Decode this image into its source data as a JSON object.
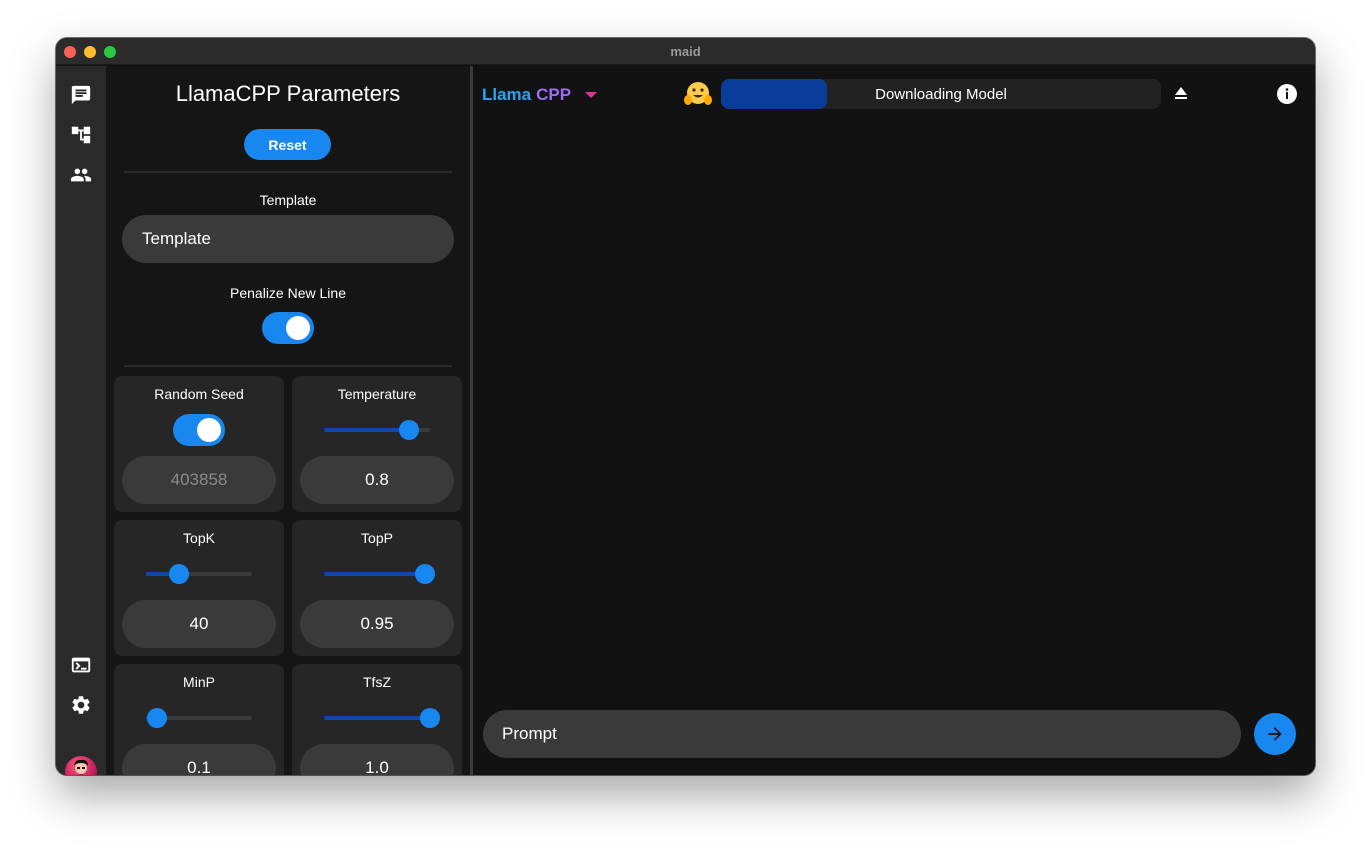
{
  "window": {
    "title": "maid"
  },
  "rail": {
    "items": [
      {
        "icon": "chat-icon"
      },
      {
        "icon": "hierarchy-icon"
      },
      {
        "icon": "people-icon"
      },
      {
        "icon": "terminal-icon"
      },
      {
        "icon": "gear-icon"
      },
      {
        "icon": "avatar"
      }
    ]
  },
  "panel": {
    "title": "LlamaCPP Parameters",
    "reset_label": "Reset",
    "template_label": "Template",
    "template_placeholder": "Template",
    "penalize_label": "Penalize New Line",
    "penalize_on": true,
    "cards": [
      {
        "label": "Random Seed",
        "value": "403858",
        "toggle_on": true
      },
      {
        "label": "Temperature",
        "value": "0.8",
        "slider_fraction": 0.8
      },
      {
        "label": "TopK",
        "value": "40",
        "slider_fraction": 0.31
      },
      {
        "label": "TopP",
        "value": "0.95",
        "slider_fraction": 0.95
      },
      {
        "label": "MinP",
        "value": "0.1",
        "slider_fraction": 0.1
      },
      {
        "label": "TfsZ",
        "value": "1.0",
        "slider_fraction": 1.0
      }
    ]
  },
  "main": {
    "api_part1": "Llama",
    "api_part2": "CPP",
    "progress_text": "Downloading Model",
    "progress_fraction": 0.24,
    "prompt_placeholder": "Prompt"
  },
  "colors": {
    "accent": "#1888f0",
    "api_llama": "#2ba2f4",
    "api_cpp": "#9b6df2",
    "caret": "#e0339b",
    "progress_fill": "#0a3d99"
  }
}
